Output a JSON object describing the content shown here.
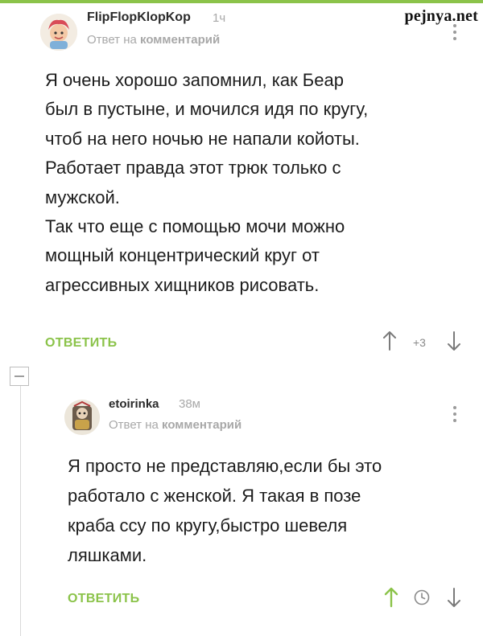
{
  "watermark": "pejnya.net",
  "comments": [
    {
      "username": "FlipFlopKlopKop",
      "time": "1ч",
      "reply_prefix": "Ответ на",
      "reply_target": "комментарий",
      "text": "Я очень хорошо запомнил, как Беар\nбыл в пустыне, и мочился идя по кругу,\nчтоб на него ночью не напали койоты.\nРаботает правда этот трюк только с\nмужской.\nТак что еще с помощью мочи можно\nмощный концентрический круг от\nагрессивных хищников рисовать.",
      "reply_label": "ОТВЕТИТЬ",
      "score": "+3"
    },
    {
      "username": "etoirinka",
      "time": "38м",
      "reply_prefix": "Ответ на",
      "reply_target": "комментарий",
      "text": "Я просто не представляю,если бы это\nработало с женской. Я такая в позе\nкраба ссу по кругу,быстро шевеля\nляшками.",
      "reply_label": "ОТВЕТИТЬ",
      "upvoted": true
    }
  ],
  "colors": {
    "accent": "#8bc34a",
    "muted": "#a8a8a8",
    "text": "#1c1c1c"
  },
  "icons": [
    "upvote-arrow-icon",
    "downvote-arrow-icon",
    "clock-icon",
    "more-options-icon",
    "collapse-thread-icon"
  ]
}
